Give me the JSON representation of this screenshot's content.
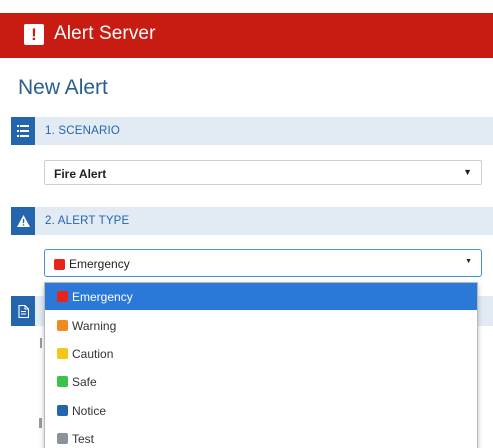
{
  "app": {
    "title": "Alert Server",
    "logo_glyph": "!",
    "brand_color": "#c81b12"
  },
  "page": {
    "title": "New Alert"
  },
  "sections": {
    "scenario": {
      "label": "1. SCENARIO",
      "icon": "list-icon",
      "selected_value": "Fire Alert"
    },
    "alert_type": {
      "label": "2. ALERT TYPE",
      "icon": "warning-icon",
      "selected_value": "Emergency",
      "selected_color": "#e8231a"
    },
    "third": {
      "icon": "document-icon"
    }
  },
  "dropdown": {
    "options": [
      {
        "label": "Emergency",
        "color": "#e8231a",
        "selected": true
      },
      {
        "label": "Warning",
        "color": "#f08a1c",
        "selected": false
      },
      {
        "label": "Caution",
        "color": "#f5c518",
        "selected": false
      },
      {
        "label": "Safe",
        "color": "#3cc24a",
        "selected": false
      },
      {
        "label": "Notice",
        "color": "#2565ad",
        "selected": false
      },
      {
        "label": "Test",
        "color": "#8a939c",
        "selected": false
      }
    ]
  },
  "colors": {
    "accent": "#2565ad",
    "section_bg": "#e2ebf3",
    "highlight": "#2a78d8"
  }
}
